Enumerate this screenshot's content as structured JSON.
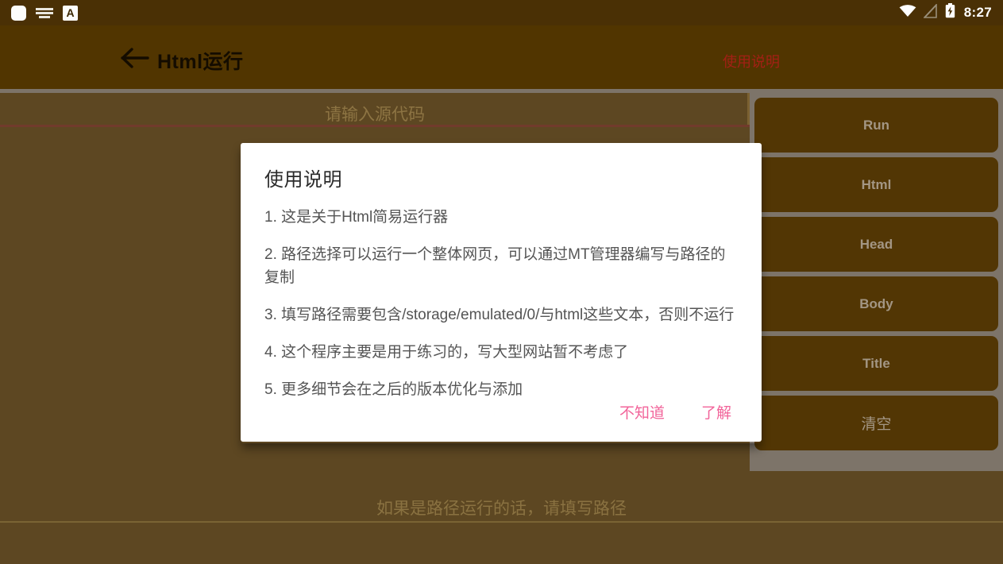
{
  "statusbar": {
    "notification_icons": [
      "app-notification-icon",
      "keyboard-icon",
      "alphabet-a-icon"
    ],
    "alphabet_label": "A",
    "system_icons": [
      "wifi-icon",
      "signal-off-icon",
      "battery-charging-icon"
    ],
    "time": "8:27"
  },
  "appbar": {
    "back_label": "back-arrow-icon",
    "title": "Html运行",
    "action_label": "使用说明",
    "action_color": "#a32015",
    "background_color": "#513500"
  },
  "editor": {
    "code_placeholder": "请输入源代码",
    "code_value": "",
    "path_placeholder": "如果是路径运行的话，请填写路径",
    "path_value": ""
  },
  "sidebar": {
    "buttons": [
      {
        "label": "Run",
        "name": "run-button",
        "cjk": false
      },
      {
        "label": "Html",
        "name": "html-button",
        "cjk": false
      },
      {
        "label": "Head",
        "name": "head-button",
        "cjk": false
      },
      {
        "label": "Body",
        "name": "body-button",
        "cjk": false
      },
      {
        "label": "Title",
        "name": "title-button",
        "cjk": false
      },
      {
        "label": "清空",
        "name": "clear-button",
        "cjk": true
      }
    ],
    "button_color": "#523604",
    "track_color": "#7d7469"
  },
  "dialog": {
    "title": "使用说明",
    "items": [
      "1. 这是关于Html简易运行器",
      " 2. 路径选择可以运行一个整体网页，可以通过MT管理器编写与路径的复制",
      "3. 填写路径需要包含/storage/emulated/0/与html这些文本，否则不运行",
      "4. 这个程序主要是用于练习的，写大型网站暂不考虑了",
      "5. 更多细节会在之后的版本优化与添加"
    ],
    "negative_label": "不知道",
    "positive_label": "了解",
    "button_color": "#f2649a"
  }
}
